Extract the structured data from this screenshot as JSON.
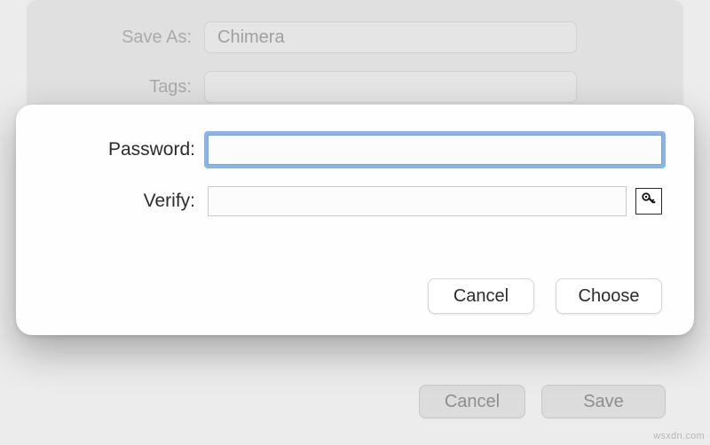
{
  "save_sheet": {
    "save_as_label": "Save As:",
    "save_as_value": "Chimera",
    "tags_label": "Tags:",
    "tags_value": "",
    "cancel_label": "Cancel",
    "save_label": "Save"
  },
  "password_modal": {
    "password_label": "Password:",
    "password_value": "",
    "verify_label": "Verify:",
    "verify_value": "",
    "cancel_label": "Cancel",
    "choose_label": "Choose"
  },
  "watermark": "wsxdn.com"
}
